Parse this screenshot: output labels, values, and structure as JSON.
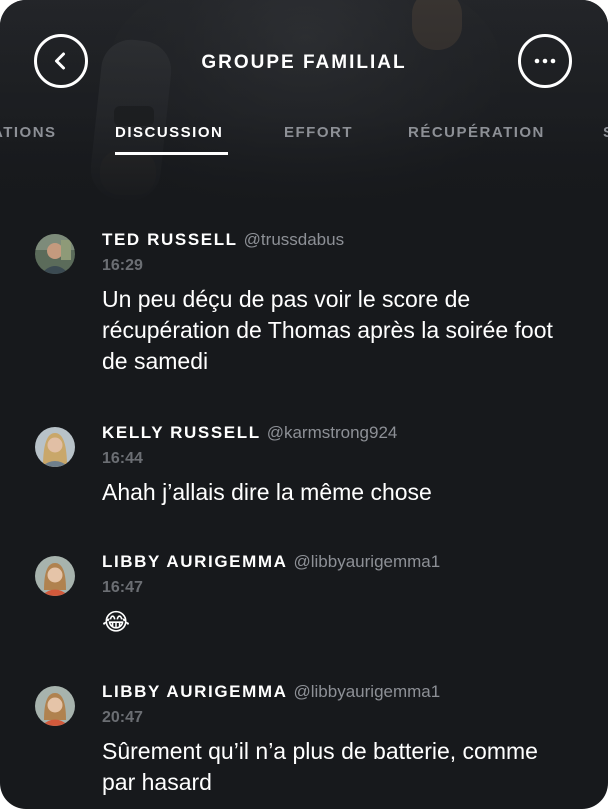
{
  "header": {
    "title": "GROUPE FAMILIAL",
    "back_icon": "chevron-left-icon",
    "more_icon": "more-horizontal-icon"
  },
  "tabs": [
    {
      "label": "ATIONS",
      "active": false
    },
    {
      "label": "DISCUSSION",
      "active": true
    },
    {
      "label": "EFFORT",
      "active": false
    },
    {
      "label": "RÉCUPÉRATION",
      "active": false
    },
    {
      "label": "S",
      "active": false
    }
  ],
  "messages": [
    {
      "name": "TED RUSSELL",
      "handle": "@trussdabus",
      "time": "16:29",
      "text": "Un peu déçu de pas voir le score de récupération de Thomas après la soirée foot de samedi"
    },
    {
      "name": "KELLY RUSSELL",
      "handle": "@karmstrong924",
      "time": "16:44",
      "text": "Ahah j’allais dire la même chose"
    },
    {
      "name": "LIBBY AURIGEMMA",
      "handle": "@libbyaurigemma1",
      "time": "16:47",
      "text": "😂"
    },
    {
      "name": "LIBBY AURIGEMMA",
      "handle": "@libbyaurigemma1",
      "time": "20:47",
      "text": "Sûrement qu’il n’a plus de batterie, comme par hasard"
    }
  ],
  "colors": {
    "background": "#17191c",
    "text_primary": "#ffffff",
    "text_secondary": "#8d9096",
    "time": "#6b6e73"
  }
}
